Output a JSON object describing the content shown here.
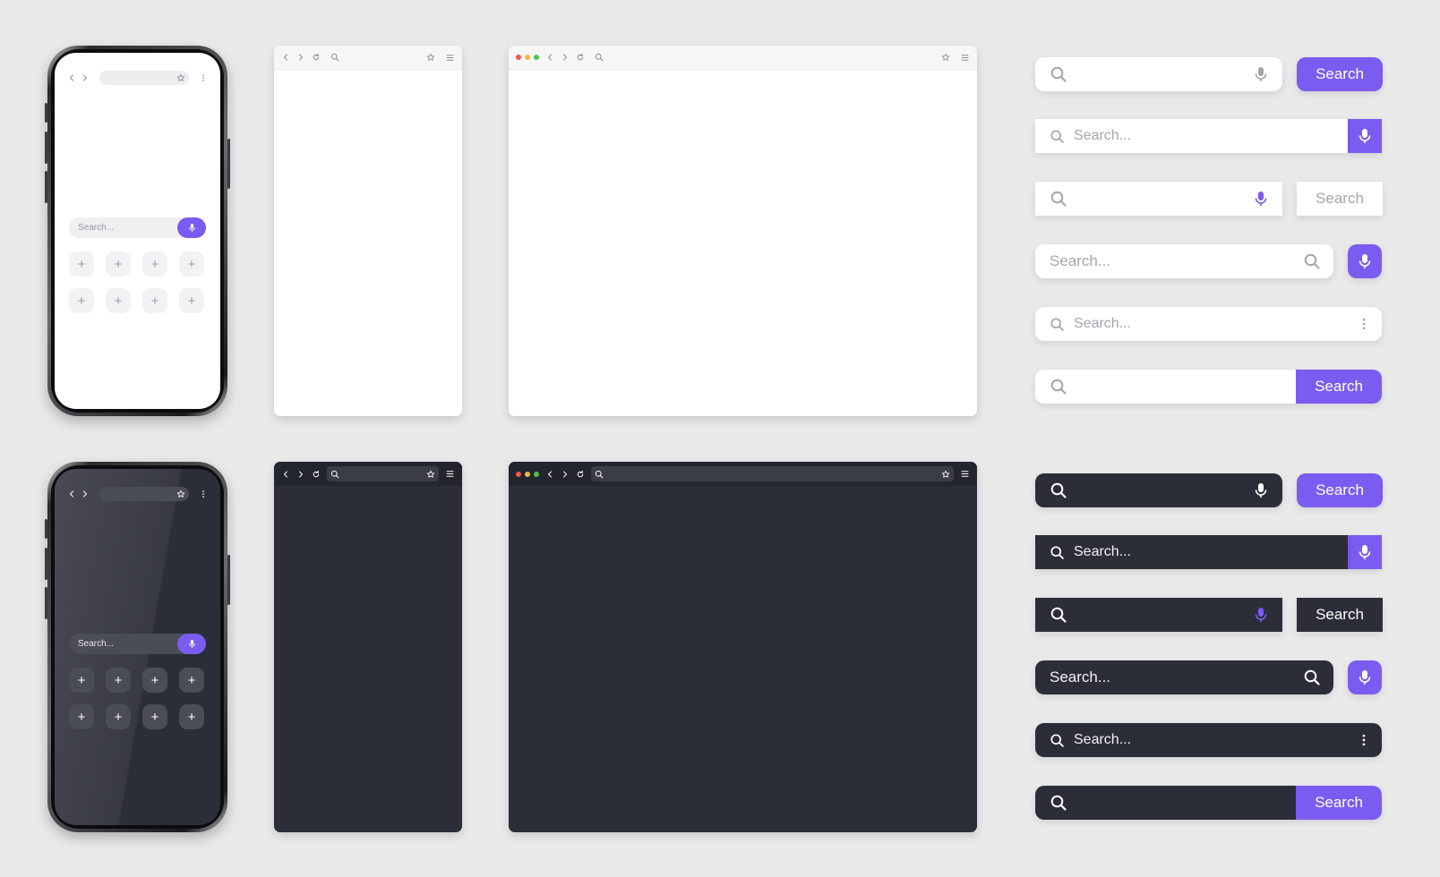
{
  "colors": {
    "background": "#e9e9ea",
    "accent": "#7b5cf0",
    "dark_surface": "#2b2d38",
    "light_surface": "#ffffff"
  },
  "phones": {
    "search_placeholder": "Search...",
    "tile_glyph": "+",
    "icons": [
      "chevron-left-icon",
      "chevron-right-icon",
      "star-icon",
      "more-vertical-icon",
      "mic-icon",
      "plus-icon"
    ]
  },
  "browser_icons": [
    "chevron-left-icon",
    "chevron-right-icon",
    "reload-icon",
    "search-icon",
    "star-icon",
    "menu-icon"
  ],
  "window_dots": [
    "#f0564f",
    "#f5b83b",
    "#4fc24c"
  ],
  "light_search_bars": {
    "bar1_button": "Search",
    "bar2_placeholder": "Search...",
    "bar3_button": "Search",
    "bar4_placeholder": "Search...",
    "bar5_placeholder": "Search...",
    "bar6_button": "Search"
  },
  "dark_search_bars": {
    "bar1_button": "Search",
    "bar2_placeholder": "Search...",
    "bar3_button": "Search",
    "bar4_placeholder": "Search...",
    "bar5_placeholder": "Search...",
    "bar6_button": "Search"
  }
}
